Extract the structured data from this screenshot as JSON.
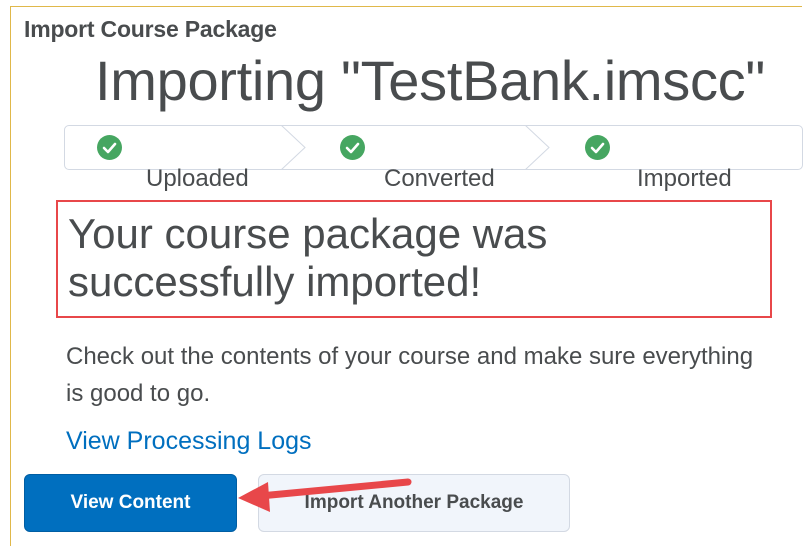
{
  "header": {
    "title": "Import Course Package"
  },
  "importing": {
    "title": "Importing \"TestBank.imscc\""
  },
  "steps": [
    {
      "label": "Uploaded",
      "status": "complete",
      "icon": "check-circle-icon"
    },
    {
      "label": "Converted",
      "status": "complete",
      "icon": "check-circle-icon"
    },
    {
      "label": "Imported",
      "status": "complete",
      "icon": "check-circle-icon"
    }
  ],
  "success": {
    "message": "Your course package was successfully imported!"
  },
  "description": "Check out the contents of your course and make sure everything is good to go.",
  "links": {
    "processing_logs": "View Processing Logs"
  },
  "buttons": {
    "view_content": "View Content",
    "import_another": "Import Another Package"
  },
  "colors": {
    "primary": "#006fbf",
    "success_green": "#46a661",
    "highlight_red": "#e8474a",
    "annotation_arrow": "#e8474a"
  }
}
